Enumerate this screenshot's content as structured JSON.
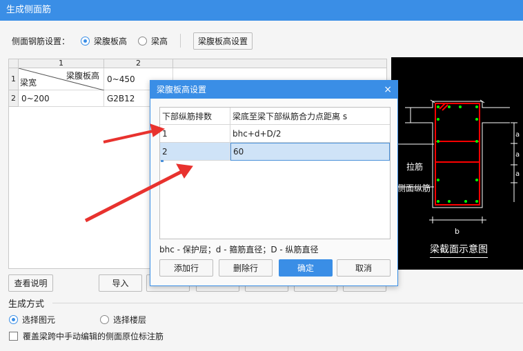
{
  "window": {
    "title": "生成侧面筋"
  },
  "settings": {
    "label": "侧面钢筋设置：",
    "options": [
      "梁腹板高",
      "梁高"
    ],
    "selected": 0,
    "button": "梁腹板高设置"
  },
  "grid": {
    "col_headers": [
      "1",
      "2"
    ],
    "row_headers": [
      "1",
      "2"
    ],
    "header_cell": {
      "top_right": "梁腹板高",
      "bottom_left": "梁宽"
    },
    "cells": [
      [
        "",
        "0~450"
      ],
      [
        "0~200",
        "G2B12"
      ]
    ]
  },
  "diagram": {
    "labels": {
      "tie": "拉筋",
      "side": "侧面纵筋",
      "width": "b",
      "a": "a",
      "caption": "梁截面示意图"
    }
  },
  "bottom_buttons": {
    "help": "查看说明",
    "import": "导入"
  },
  "generation": {
    "title": "生成方式",
    "options": [
      "选择图元",
      "选择楼层"
    ],
    "selected": 0,
    "checkbox_label": "覆盖梁跨中手动编辑的侧面原位标注筋",
    "checkbox_checked": false
  },
  "dialog": {
    "title": "梁腹板高设置",
    "close": "×",
    "columns": [
      "下部纵筋排数",
      "梁底至梁下部纵筋合力点距离 s"
    ],
    "rows": [
      [
        "1",
        "bhc+d+D/2"
      ],
      [
        "2",
        "60"
      ]
    ],
    "note": "bhc - 保护层；d - 箍筋直径；D - 纵筋直径",
    "buttons": {
      "add": "添加行",
      "delete": "删除行",
      "ok": "确定",
      "cancel": "取消"
    }
  },
  "colors": {
    "accent": "#3a8ee6",
    "arrow": "#e8322e",
    "rebar": "#ff0000",
    "stirrup_dot": "#00ff00"
  }
}
